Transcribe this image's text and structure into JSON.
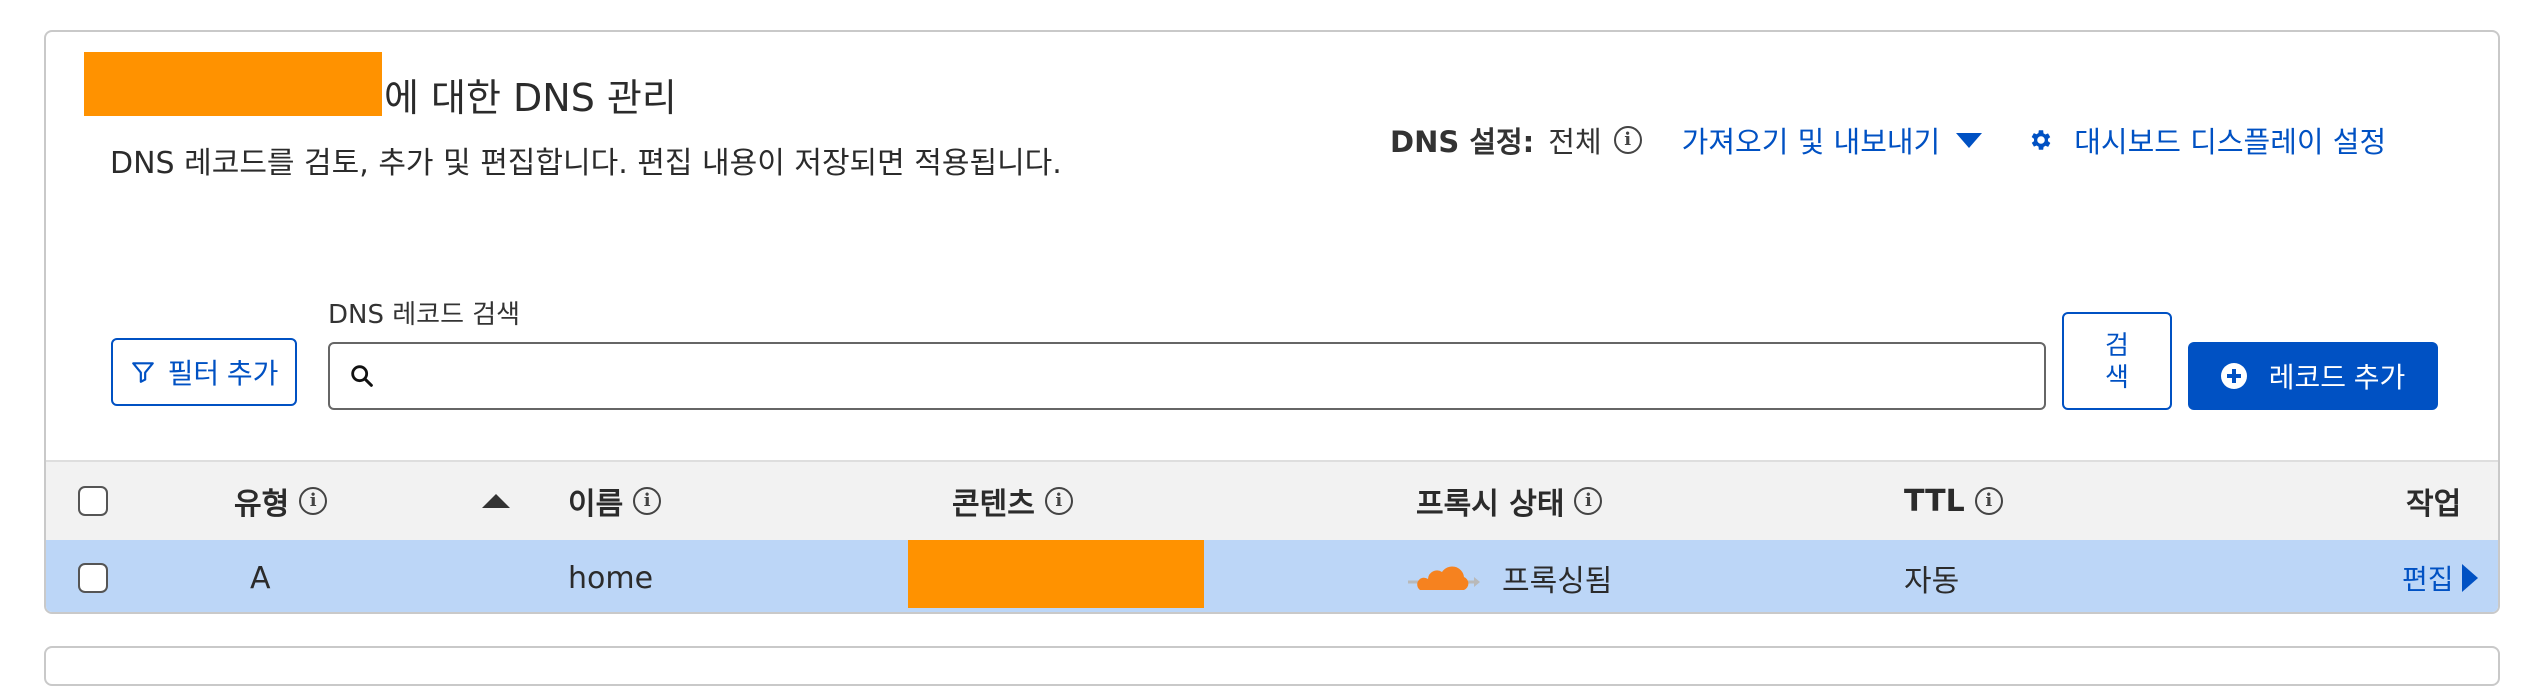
{
  "header": {
    "title_suffix": "에 대한 DNS 관리",
    "description": "DNS 레코드를 검토, 추가 및 편집합니다. 편집 내용이 저장되면 적용됩니다.",
    "dns_setting_label": "DNS 설정:",
    "dns_setting_value": "전체",
    "import_export_label": "가져오기 및 내보내기",
    "dashboard_display_label": "대시보드 디스플레이 설정"
  },
  "toolbar": {
    "filter_label": "필터 추가",
    "search_label": "DNS 레코드 검색",
    "search_placeholder": "",
    "search_button": "검\n색",
    "add_record_label": "레코드 추가"
  },
  "table": {
    "columns": {
      "type": "유형",
      "name": "이름",
      "content": "콘텐츠",
      "proxy": "프록시 상태",
      "ttl": "TTL",
      "actions": "작업"
    },
    "rows": [
      {
        "type": "A",
        "name": "home",
        "content": "",
        "proxy": "프록싱됨",
        "ttl": "자동",
        "edit": "편집"
      }
    ]
  },
  "colors": {
    "accent": "#0051c3",
    "redaction": "#ff9200",
    "row_selected": "#bcd6f7",
    "cloud": "#f6821f"
  },
  "icons": {
    "info": "info-icon",
    "filter": "filter-icon",
    "search": "search-icon",
    "gear": "gear-icon",
    "plus": "plus-circle-icon",
    "cloud": "proxied-cloud-icon"
  }
}
